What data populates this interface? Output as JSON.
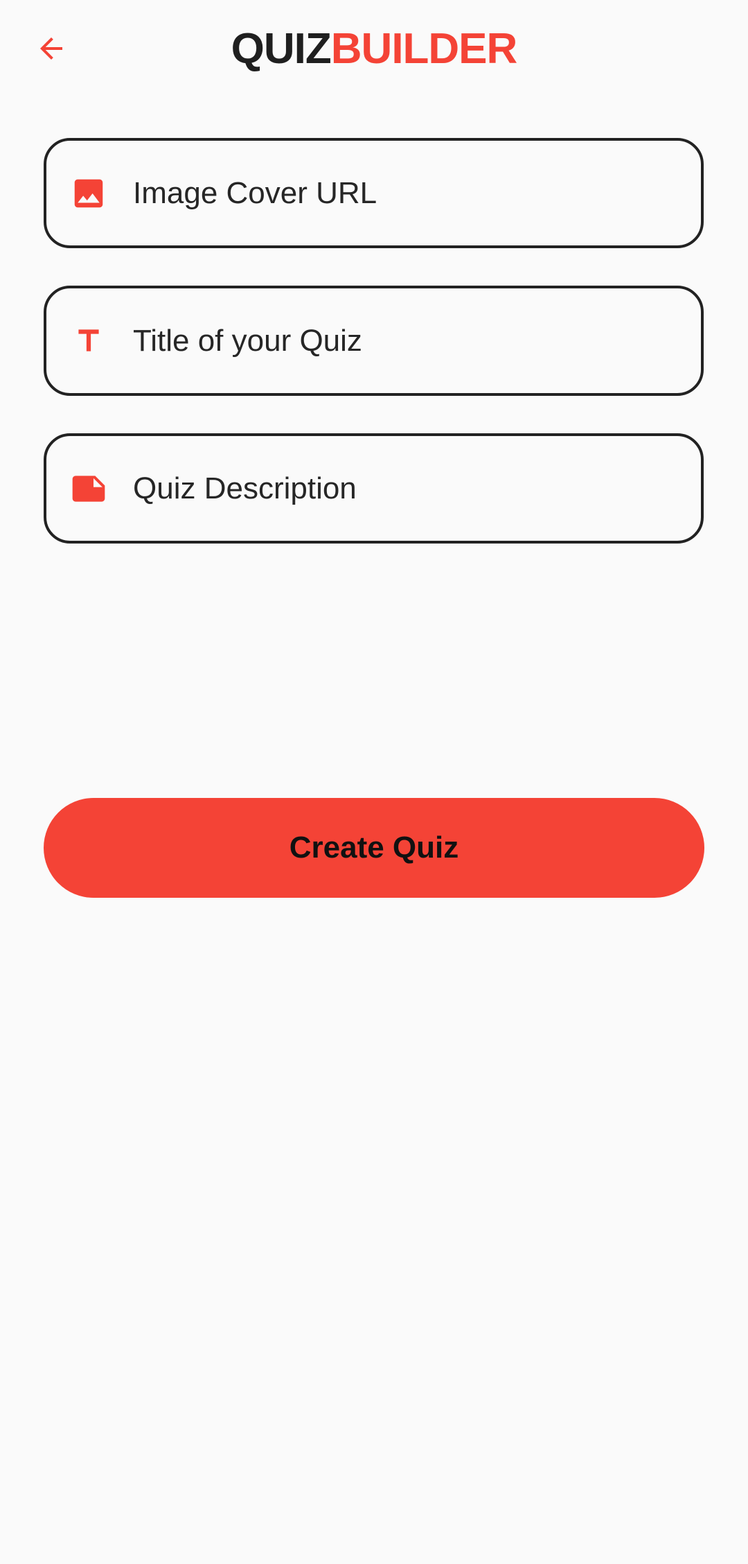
{
  "colors": {
    "accent": "#f44336",
    "text_dark": "#1f1f1f",
    "field_border": "#222222",
    "background": "#fafafa"
  },
  "header": {
    "back_icon": "arrow-back-icon",
    "title_part1": "QUIZ",
    "title_part2": "BUILDER"
  },
  "form": {
    "image_cover": {
      "icon": "image-icon",
      "placeholder": "Image Cover URL"
    },
    "title": {
      "icon": "text-format-icon",
      "placeholder": "Title of your Quiz"
    },
    "description": {
      "icon": "note-icon",
      "placeholder": "Quiz Description"
    }
  },
  "actions": {
    "create_label": "Create Quiz"
  }
}
